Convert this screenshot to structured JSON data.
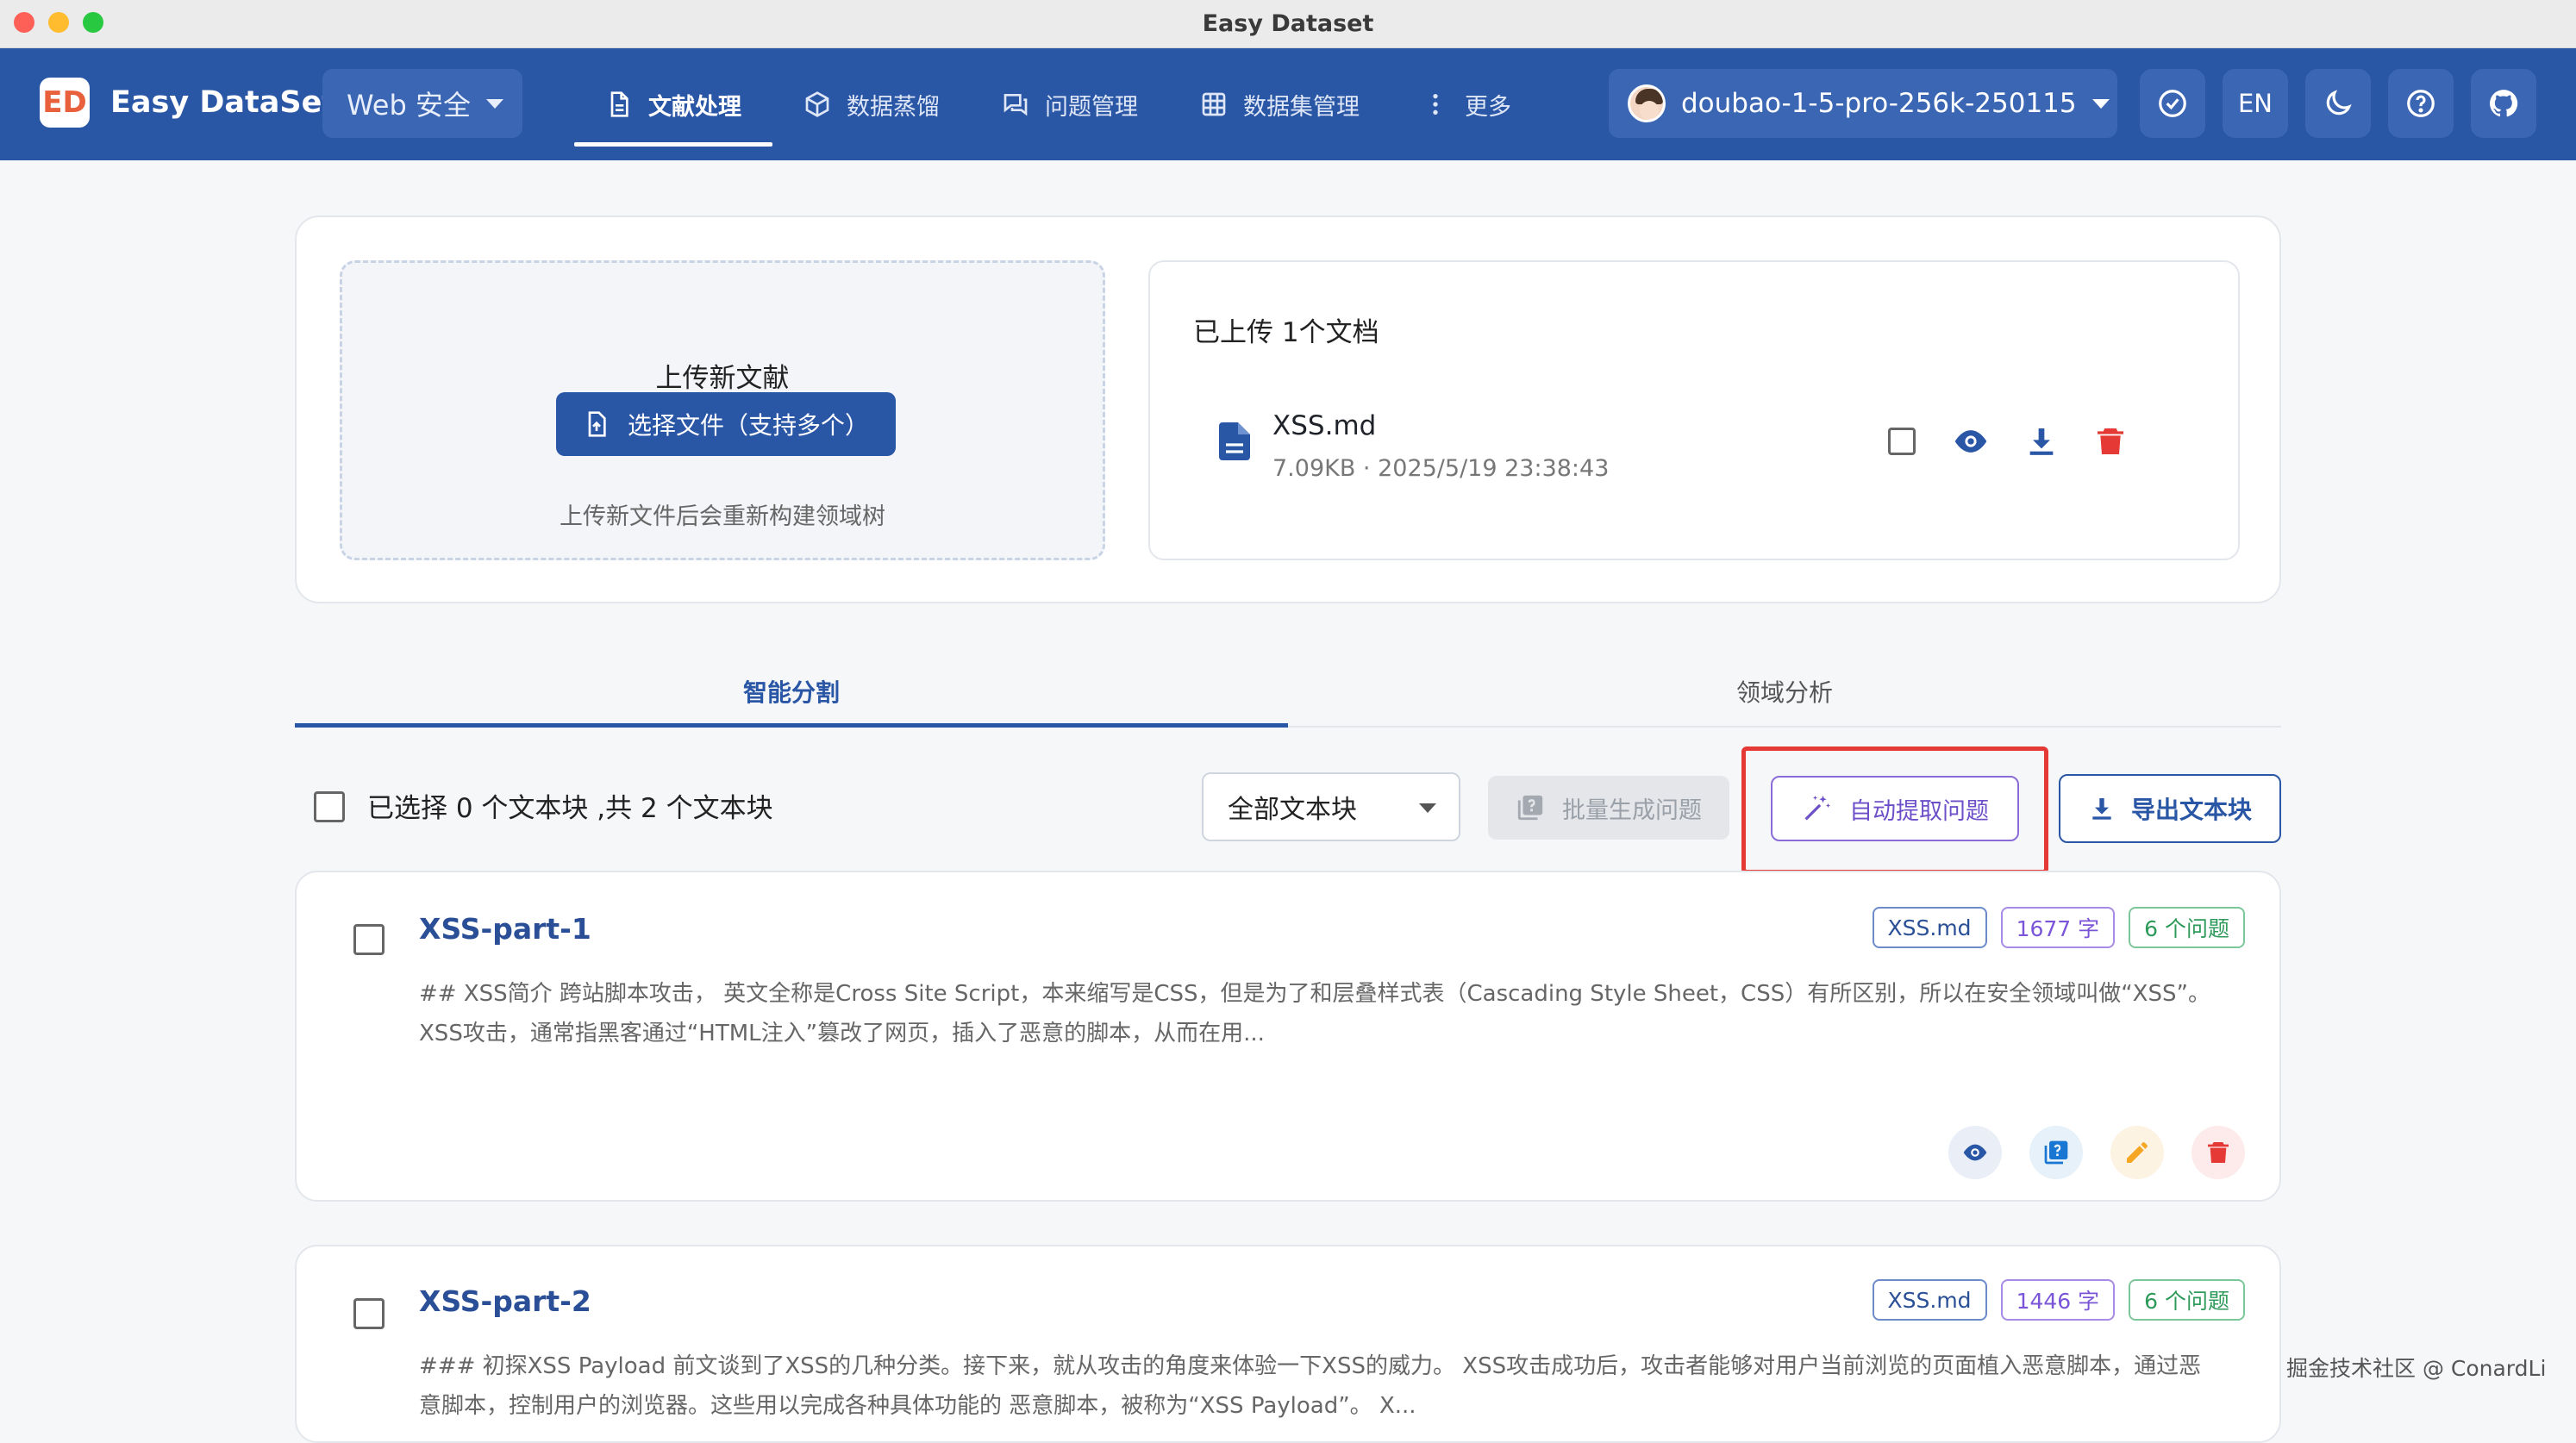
{
  "window": {
    "title": "Easy Dataset"
  },
  "header": {
    "brand_logo_text": "ED",
    "brand_name": "Easy DataSet",
    "project": "Web 安全",
    "nav": [
      {
        "label": "文献处理",
        "icon": "document-icon",
        "active": true
      },
      {
        "label": "数据蒸馏",
        "icon": "cube-icon",
        "active": false
      },
      {
        "label": "问题管理",
        "icon": "chat-icon",
        "active": false
      },
      {
        "label": "数据集管理",
        "icon": "grid-icon",
        "active": false
      },
      {
        "label": "更多",
        "icon": "more-vertical-icon",
        "active": false
      }
    ],
    "model": "doubao-1-5-pro-256k-250115",
    "lang": "EN"
  },
  "upload": {
    "title": "上传新文献",
    "button": "选择文件（支持多个）",
    "hint": "上传新文件后会重新构建领域树"
  },
  "files": {
    "title": "已上传 1个文档",
    "items": [
      {
        "name": "XSS.md",
        "meta": "7.09KB · 2025/5/19 23:38:43"
      }
    ]
  },
  "tabs": [
    {
      "label": "智能分割",
      "active": true
    },
    {
      "label": "领域分析",
      "active": false
    }
  ],
  "toolbar": {
    "selection_text": "已选择 0 个文本块 ,共 2 个文本块",
    "filter": "全部文本块",
    "batch_button": "批量生成问题",
    "auto_button": "自动提取问题",
    "export_button": "导出文本块"
  },
  "chunks": [
    {
      "title": "XSS-part-1",
      "file_tag": "XSS.md",
      "chars_tag": "1677 字",
      "questions_tag": "6 个问题",
      "text": "## XSS简介 跨站脚本攻击， 英文全称是Cross Site Script，本来缩写是CSS，但是为了和层叠样式表（Cascading Style Sheet，CSS）有所区别，所以在安全领域叫做“XSS”。 XSS攻击，通常指黑客通过“HTML注入”篡改了网页，插入了恶意的脚本，从而在用..."
    },
    {
      "title": "XSS-part-2",
      "file_tag": "XSS.md",
      "chars_tag": "1446 字",
      "questions_tag": "6 个问题",
      "text": "### 初探XSS Payload 前文谈到了XSS的几种分类。接下来，就从攻击的角度来体验一下XSS的威力。 XSS攻击成功后，攻击者能够对用户当前浏览的页面植入恶意脚本，通过恶意脚本，控制用户的浏览器。这些用以完成各种具体功能的 恶意脚本，被称为“XSS Payload”。 X..."
    }
  ],
  "watermark": "掘金技术社区 @ ConardLi",
  "colors": {
    "primary": "#2a56a6",
    "danger": "#e53935",
    "accent_purple": "#6d4fc9",
    "success": "#2e9a5a",
    "warning": "#f5a623"
  }
}
